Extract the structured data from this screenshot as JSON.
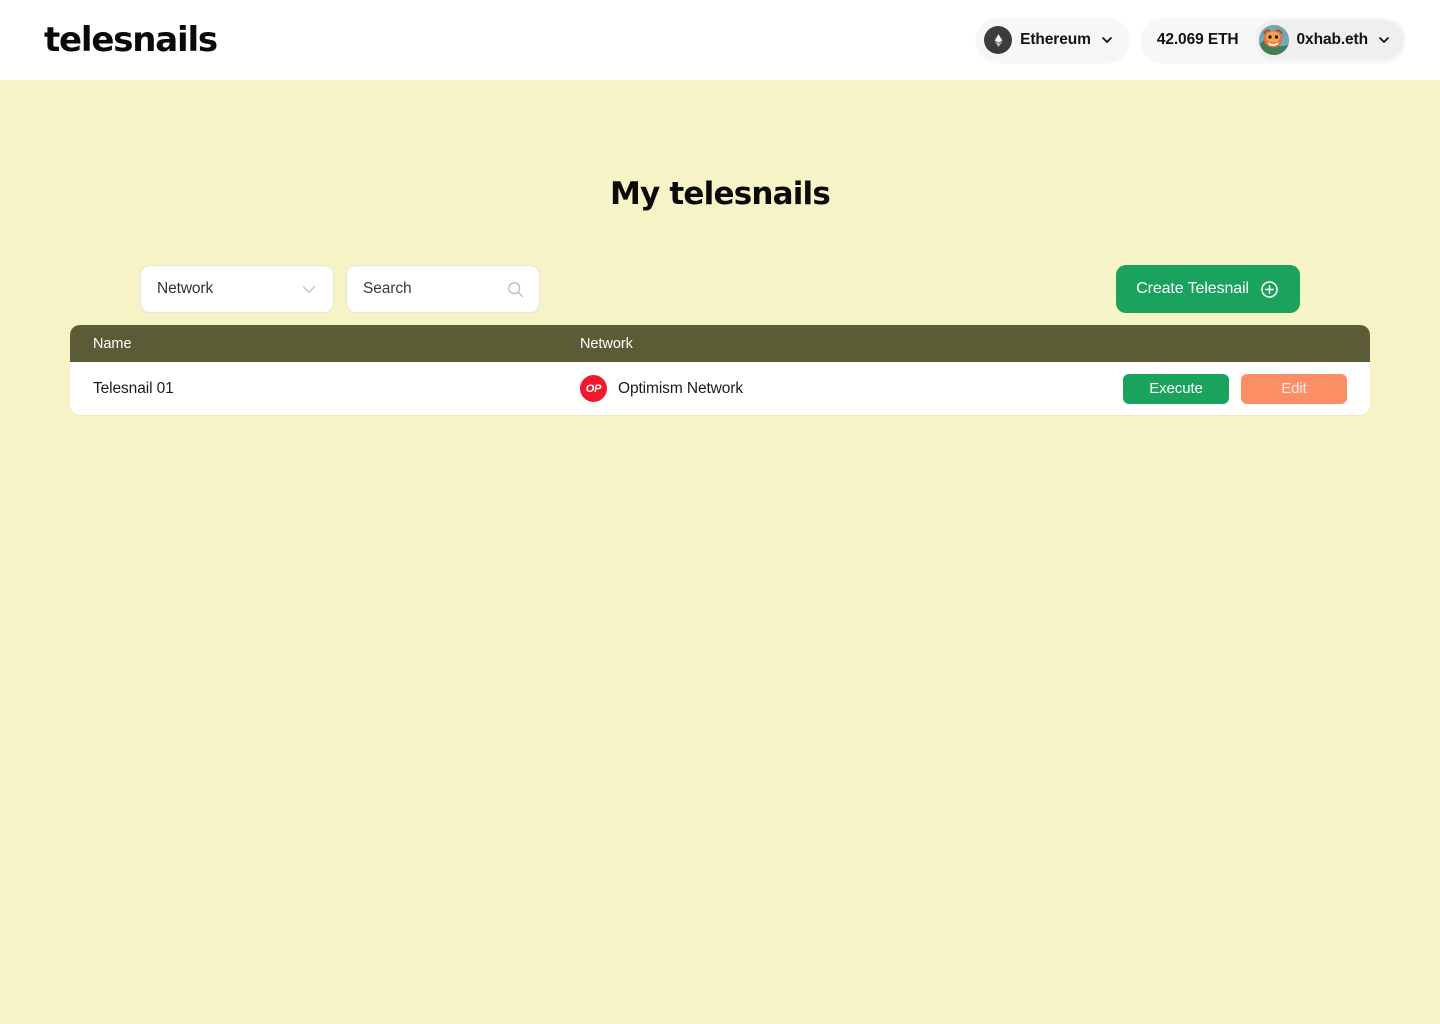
{
  "header": {
    "logo_text": "telesnails",
    "network_selector": {
      "icon": "ethereum-icon",
      "label": "Ethereum",
      "chevron": "chevron-down-icon"
    },
    "balance": "42.069 ETH",
    "account": {
      "avatar": "user-avatar",
      "label": "0xhab.eth",
      "chevron": "chevron-down-icon"
    }
  },
  "main": {
    "title": "My telesnails",
    "filters": {
      "network_select": {
        "value": "Network",
        "icon": "chevron-down-icon"
      },
      "search": {
        "placeholder": "Search",
        "value": "",
        "icon": "search-icon"
      }
    },
    "create_button": {
      "label": "Create Telesnail",
      "icon": "plus-circle-icon"
    },
    "table": {
      "columns": [
        "Name",
        "Network"
      ],
      "rows": [
        {
          "name": "Telesnail 01",
          "network": "Optimism Network",
          "network_badge": "OP",
          "actions": {
            "execute": "Execute",
            "edit": "Edit"
          }
        }
      ]
    }
  },
  "colors": {
    "page_background": "#f6f4c6",
    "header_background": "#ffffff",
    "table_header": "#5b5c36",
    "accent_green": "#1aa35c",
    "accent_coral": "#fa8f66",
    "optimism_red": "#f01a2b"
  }
}
